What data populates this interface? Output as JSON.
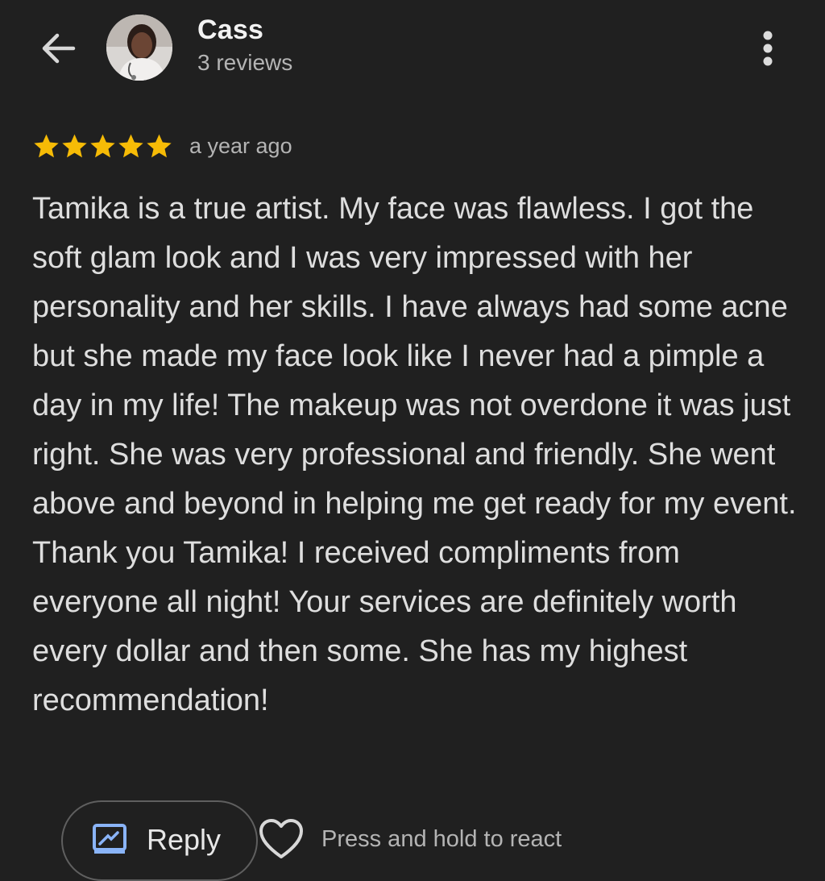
{
  "header": {
    "reviewer_name": "Cass",
    "review_count": "3 reviews",
    "back_icon": "arrow-left-icon",
    "more_icon": "more-vertical-icon"
  },
  "review": {
    "rating": 5,
    "rating_max": 5,
    "star_color": "#f6bb06",
    "time_ago": "a year ago",
    "text": "Tamika is a true artist. My face was flawless. I got the soft glam look and I was very impressed with her personality and her skills. I have always had some acne but she made my face look like I never had a pimple a day in my life! The makeup was not overdone it was just right. She was very professional and friendly. She went above and beyond in helping me get ready for my event. Thank you Tamika! I received compliments from everyone all night! Your services are definitely worth every dollar and then some. She has my highest recommendation!"
  },
  "actions": {
    "reply_label": "Reply",
    "reply_icon": "reply-icon",
    "heart_icon": "heart-outline-icon",
    "react_hint": "Press and hold to react",
    "accent_color": "#8ab4f8"
  }
}
